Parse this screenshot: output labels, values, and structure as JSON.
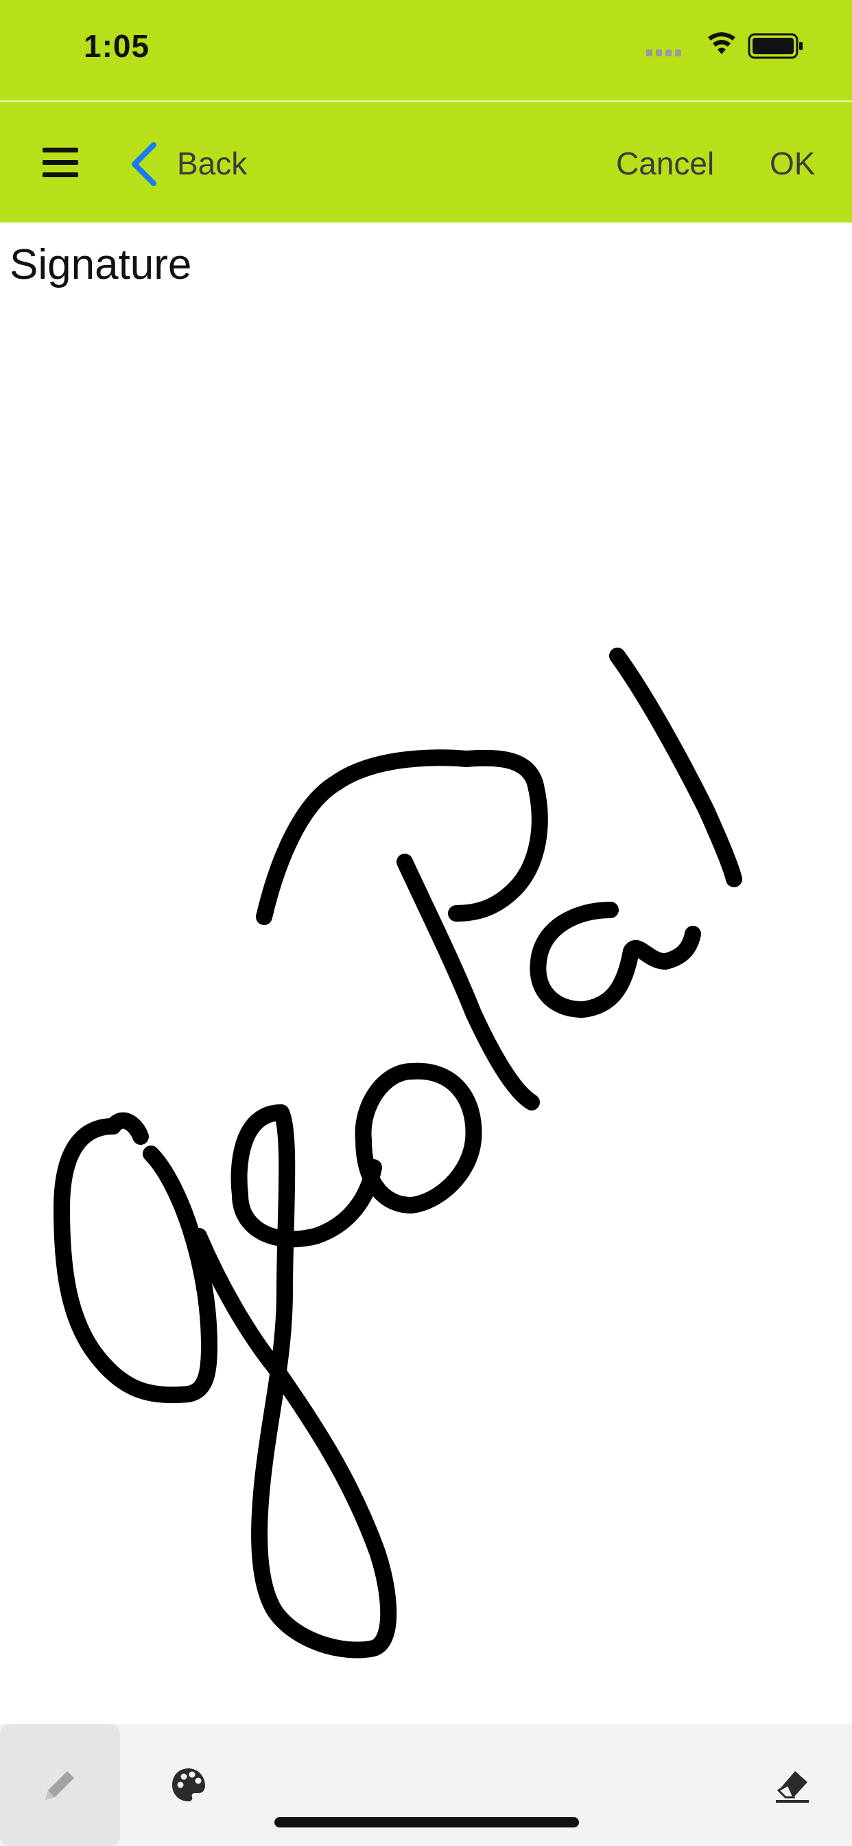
{
  "status_bar": {
    "time": "1:05",
    "icons": [
      "signal-icon",
      "wifi-icon",
      "battery-icon"
    ]
  },
  "nav_bar": {
    "background_color": "#b8e019",
    "back_label": "Back",
    "back_color": "#1a7cf2",
    "cancel_label": "Cancel",
    "ok_label": "OK"
  },
  "page": {
    "title": "Signature"
  },
  "toolbar": {
    "tools": [
      "pencil-icon",
      "palette-icon",
      "eraser-icon"
    ],
    "active_tool": "pencil-icon"
  }
}
